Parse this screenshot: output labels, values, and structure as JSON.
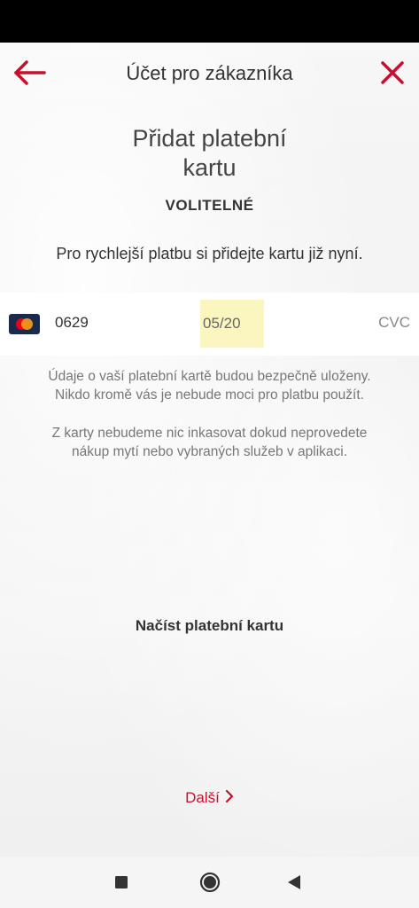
{
  "header": {
    "title": "Účet pro zákazníka",
    "back_icon": "arrow-left-icon",
    "close_icon": "close-icon",
    "accent_color": "#c8102e"
  },
  "main": {
    "title_line1": "Přidat platební",
    "title_line2": "kartu",
    "optional_label": "VOLITELNÉ",
    "subtitle": "Pro rychlejší platbu si přidejte kartu již nyní.",
    "card": {
      "brand_icon": "mastercard-icon",
      "number": "0629",
      "expiry": "05/20",
      "cvc_placeholder": "CVC",
      "expiry_highlight_color": "#fbf5c0"
    },
    "info1_line1": "Údaje o vaší platební kartě budou bezpečně uloženy.",
    "info1_line2": "Nikdo kromě vás je nebude moci pro platbu použít.",
    "info2_line1": "Z karty nebudeme nic inkasovat dokud neprovedete",
    "info2_line2": "nákup mytí nebo vybraných služeb v aplikaci.",
    "scan_card_label": "Načíst platební kartu",
    "next_label": "Další"
  },
  "navbar": {
    "recents_icon": "square-icon",
    "home_icon": "circle-icon",
    "back_icon": "triangle-back-icon"
  }
}
